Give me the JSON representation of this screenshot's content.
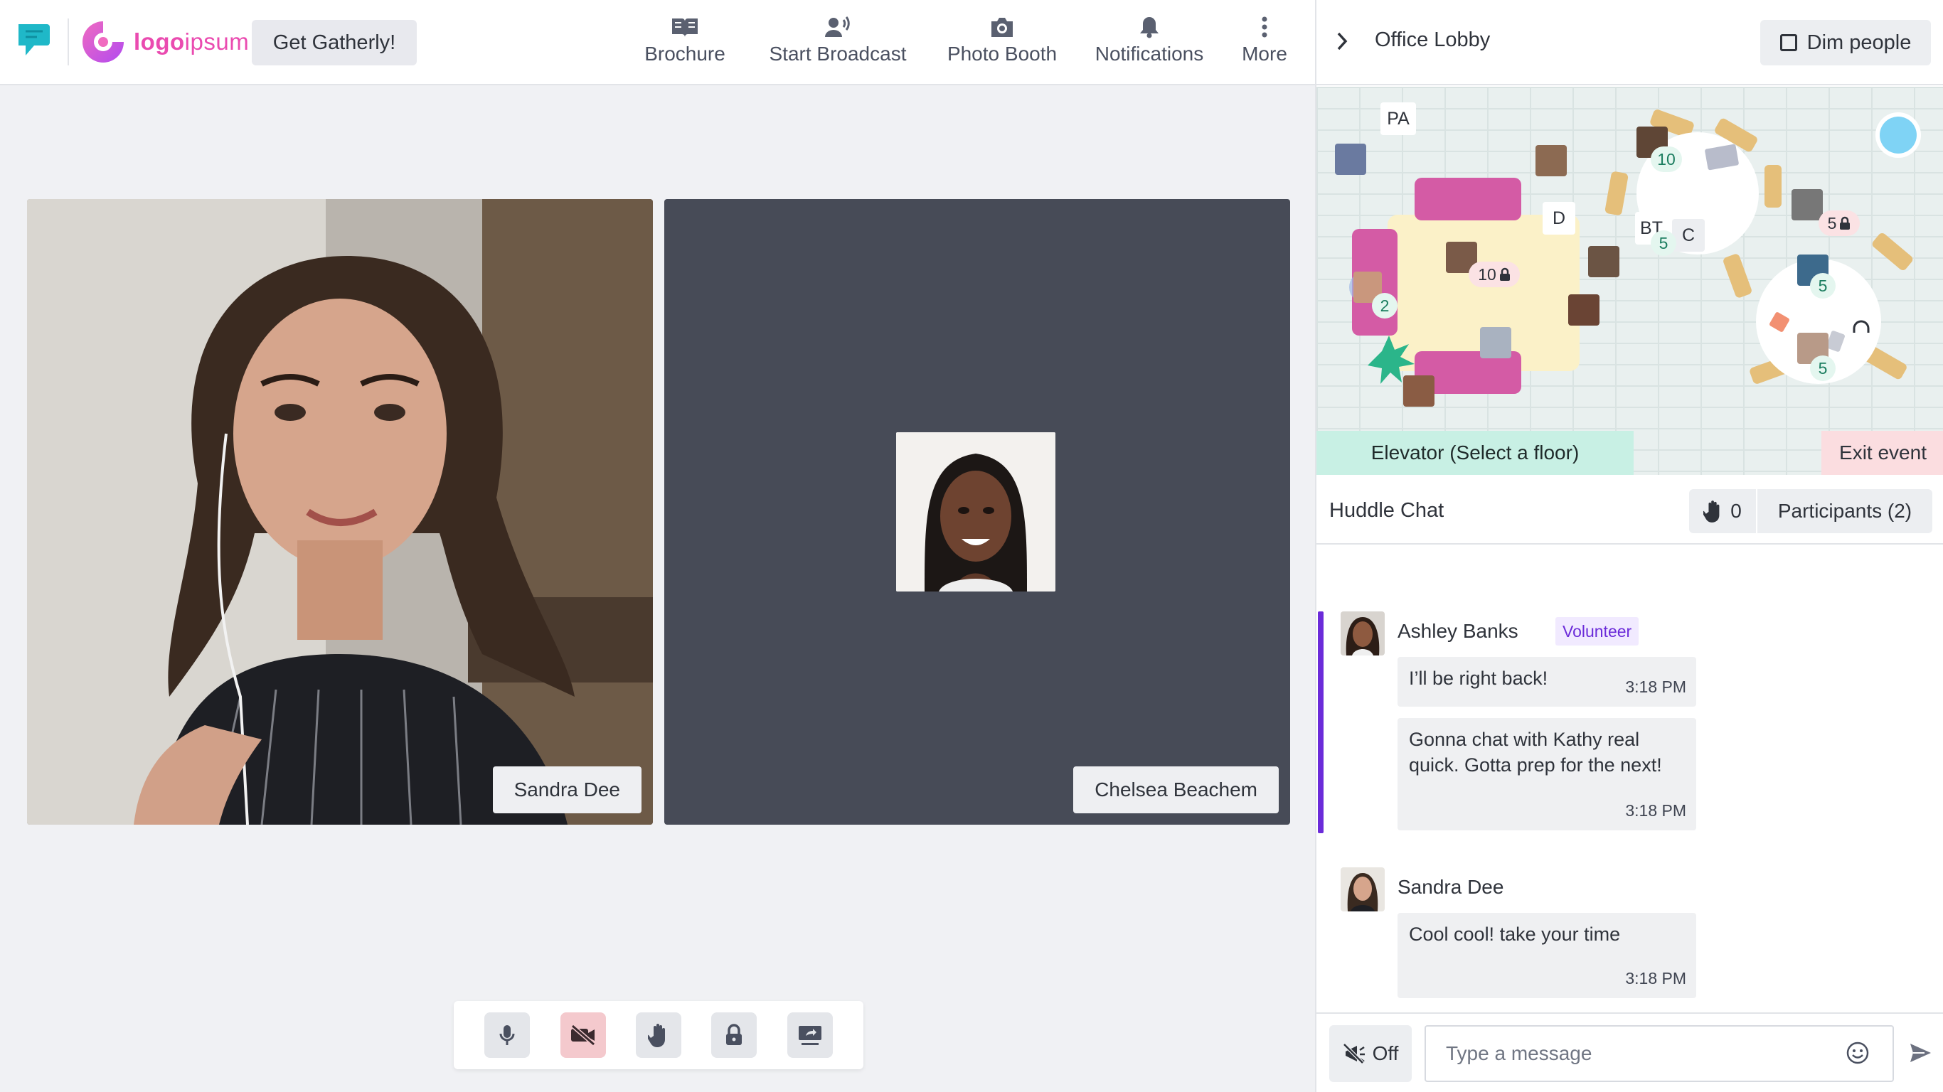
{
  "brand": {
    "logo_text_bold": "logo",
    "logo_text": "ipsum",
    "cta_label": "Get Gatherly!"
  },
  "nav": [
    {
      "label": "Brochure",
      "icon": "book-icon"
    },
    {
      "label": "Start Broadcast",
      "icon": "broadcast-icon"
    },
    {
      "label": "Photo Booth",
      "icon": "camera-icon"
    },
    {
      "label": "Notifications",
      "icon": "bell-icon"
    },
    {
      "label": "More",
      "icon": "more-vertical-icon"
    }
  ],
  "video": {
    "participants": [
      {
        "name": "Sandra Dee",
        "camera": "on"
      },
      {
        "name": "Chelsea Beachem",
        "camera": "off"
      }
    ]
  },
  "controls": [
    {
      "name": "microphone",
      "icon": "microphone-icon"
    },
    {
      "name": "camera-off",
      "icon": "video-off-icon",
      "state": "active-danger"
    },
    {
      "name": "raise-hand",
      "icon": "hand-icon"
    },
    {
      "name": "lock",
      "icon": "lock-icon"
    },
    {
      "name": "share-screen",
      "icon": "screen-share-icon"
    }
  ],
  "room": {
    "title": "Office Lobby",
    "dim_label": "Dim people"
  },
  "map": {
    "labels": {
      "pa": "PA",
      "d": "D",
      "bt": "BT",
      "c": "C"
    },
    "counts": {
      "table_top_right": "10",
      "table_left_seat": "2",
      "table_center_locked": "10",
      "bt_table": "5",
      "far_right_locked": "5",
      "round_table_top": "5",
      "round_table_bottom": "5"
    },
    "elevator_label": "Elevator (Select a floor)",
    "exit_label": "Exit event"
  },
  "chat": {
    "title": "Huddle Chat",
    "hand_count": "0",
    "participants_label": "Participants (2)",
    "groups": [
      {
        "sender": "Ashley Banks",
        "badge": "Volunteer",
        "messages": [
          {
            "text": "I’ll be right back!",
            "time": "3:18 PM"
          },
          {
            "text": "Gonna chat with Kathy real quick. Gotta prep for the next!",
            "time": "3:18 PM"
          }
        ]
      },
      {
        "sender": "Sandra Dee",
        "messages": [
          {
            "text": "Cool cool! take your time",
            "time": "3:18 PM"
          }
        ]
      }
    ],
    "notify_label": "Off",
    "input_placeholder": "Type a message"
  },
  "colors": {
    "accent_purple": "#6b2bd9",
    "brand_pink": "#ea4bb0",
    "brand_teal": "#1fb8c8",
    "elevator_bg": "#c8f0e4",
    "exit_bg": "#fbdde0"
  }
}
